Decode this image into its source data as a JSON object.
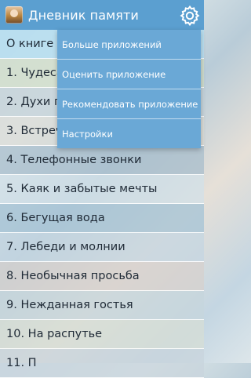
{
  "appbar": {
    "title": "Дневник памяти",
    "settings_icon": "gear-icon",
    "app_icon": "app-logo-icon"
  },
  "list": {
    "items": [
      "О книге",
      "1. Чудеса",
      "2. Духи п",
      "3. Встреч",
      "4. Телефонные звонки",
      "5. Каяк и забытые мечты",
      "6. Бегущая вода",
      "7. Лебеди и молнии",
      "8. Необычная просьба",
      "9. Нежданная гостья",
      "10. На распутье",
      "11. П"
    ]
  },
  "menu": {
    "items": [
      "Больше приложений",
      "Оценить приложение",
      "Рекомендовать приложение",
      "Настройки"
    ]
  },
  "colors": {
    "appbar": "#5b9fd0",
    "menu": "#6aa8d6",
    "selected_row": "#b6def0"
  }
}
